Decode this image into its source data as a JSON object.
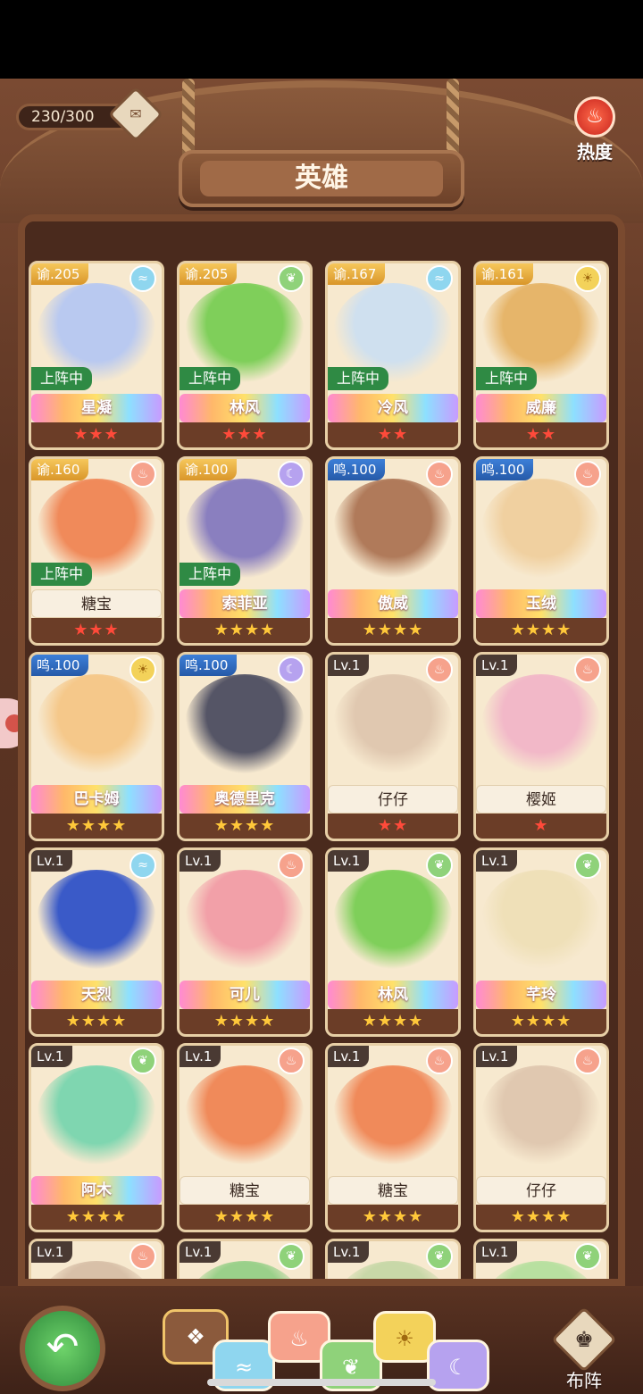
{
  "header": {
    "counter": "230/300",
    "title": "英雄",
    "hot_label": "热度"
  },
  "heroes": [
    {
      "level": "谕.205",
      "level_style": "gold",
      "element": "water",
      "deployed": "上阵中",
      "name": "星凝",
      "ribbon": "rainbow",
      "stars": "★★★",
      "star_color": "red",
      "color": "#b9c9f0"
    },
    {
      "level": "谕.205",
      "level_style": "gold",
      "element": "leaf",
      "deployed": "上阵中",
      "name": "林风",
      "ribbon": "rainbow",
      "stars": "★★★",
      "star_color": "red",
      "color": "#7fcf5a"
    },
    {
      "level": "谕.167",
      "level_style": "gold",
      "element": "water",
      "deployed": "上阵中",
      "name": "冷风",
      "ribbon": "rainbow",
      "stars": "★★",
      "star_color": "red",
      "color": "#cfe0ef"
    },
    {
      "level": "谕.161",
      "level_style": "gold",
      "element": "sun",
      "deployed": "上阵中",
      "name": "威廉",
      "ribbon": "rainbow",
      "stars": "★★",
      "star_color": "red",
      "color": "#e6b56a"
    },
    {
      "level": "谕.160",
      "level_style": "gold",
      "element": "fire",
      "deployed": "上阵中",
      "name": "糖宝",
      "ribbon": "plain",
      "stars": "★★★",
      "star_color": "red",
      "color": "#f08a5a"
    },
    {
      "level": "谕.100",
      "level_style": "gold",
      "element": "moon",
      "deployed": "上阵中",
      "name": "索菲亚",
      "ribbon": "rainbow",
      "stars": "★★★★",
      "star_color": "gold",
      "color": "#8a7fbf"
    },
    {
      "level": "鸣.100",
      "level_style": "blue",
      "element": "fire",
      "deployed": "",
      "name": "傲威",
      "ribbon": "rainbow",
      "stars": "★★★★",
      "star_color": "gold",
      "color": "#b07a5a"
    },
    {
      "level": "鸣.100",
      "level_style": "blue",
      "element": "fire",
      "deployed": "",
      "name": "玉绒",
      "ribbon": "rainbow",
      "stars": "★★★★",
      "star_color": "gold",
      "color": "#f0d0a0"
    },
    {
      "level": "鸣.100",
      "level_style": "blue",
      "element": "sun",
      "deployed": "",
      "name": "巴卡姆",
      "ribbon": "rainbow",
      "stars": "★★★★",
      "star_color": "gold",
      "color": "#f5c88a"
    },
    {
      "level": "鸣.100",
      "level_style": "blue",
      "element": "moon",
      "deployed": "",
      "name": "奥德里克",
      "ribbon": "rainbow",
      "stars": "★★★★",
      "star_color": "gold",
      "color": "#555566"
    },
    {
      "level": "Lv.1",
      "level_style": "lv",
      "element": "fire",
      "deployed": "",
      "name": "仔仔",
      "ribbon": "plain",
      "stars": "★★",
      "star_color": "red",
      "color": "#e0c8b0"
    },
    {
      "level": "Lv.1",
      "level_style": "lv",
      "element": "fire",
      "deployed": "",
      "name": "樱姬",
      "ribbon": "plain",
      "stars": "★",
      "star_color": "red",
      "color": "#f2b8c8"
    },
    {
      "level": "Lv.1",
      "level_style": "lv",
      "element": "water",
      "deployed": "",
      "name": "天烈",
      "ribbon": "rainbow",
      "stars": "★★★★",
      "star_color": "gold",
      "color": "#3a5ac8"
    },
    {
      "level": "Lv.1",
      "level_style": "lv",
      "element": "fire",
      "deployed": "",
      "name": "可儿",
      "ribbon": "rainbow",
      "stars": "★★★★",
      "star_color": "gold",
      "color": "#f2a0a8"
    },
    {
      "level": "Lv.1",
      "level_style": "lv",
      "element": "leaf",
      "deployed": "",
      "name": "林风",
      "ribbon": "rainbow",
      "stars": "★★★★",
      "star_color": "gold",
      "color": "#7fcf5a"
    },
    {
      "level": "Lv.1",
      "level_style": "lv",
      "element": "leaf",
      "deployed": "",
      "name": "芊玲",
      "ribbon": "rainbow",
      "stars": "★★★★",
      "star_color": "gold",
      "color": "#efe0b8"
    },
    {
      "level": "Lv.1",
      "level_style": "lv",
      "element": "leaf",
      "deployed": "",
      "name": "阿木",
      "ribbon": "rainbow",
      "stars": "★★★★",
      "star_color": "gold",
      "color": "#7fd6b0"
    },
    {
      "level": "Lv.1",
      "level_style": "lv",
      "element": "fire",
      "deployed": "",
      "name": "糖宝",
      "ribbon": "plain",
      "stars": "★★★★",
      "star_color": "gold",
      "color": "#f08a5a"
    },
    {
      "level": "Lv.1",
      "level_style": "lv",
      "element": "fire",
      "deployed": "",
      "name": "糖宝",
      "ribbon": "plain",
      "stars": "★★★★",
      "star_color": "gold",
      "color": "#f08a5a"
    },
    {
      "level": "Lv.1",
      "level_style": "lv",
      "element": "fire",
      "deployed": "",
      "name": "仔仔",
      "ribbon": "plain",
      "stars": "★★★★",
      "star_color": "gold",
      "color": "#e0c8b0"
    },
    {
      "level": "Lv.1",
      "level_style": "lv",
      "element": "fire",
      "deployed": "",
      "name": "",
      "ribbon": "plain",
      "stars": "",
      "star_color": "gold",
      "color": "#d8c0a8"
    },
    {
      "level": "Lv.1",
      "level_style": "lv",
      "element": "leaf",
      "deployed": "",
      "name": "",
      "ribbon": "plain",
      "stars": "",
      "star_color": "gold",
      "color": "#9ad08a"
    },
    {
      "level": "Lv.1",
      "level_style": "lv",
      "element": "leaf",
      "deployed": "",
      "name": "",
      "ribbon": "plain",
      "stars": "",
      "star_color": "gold",
      "color": "#c8d8a8"
    },
    {
      "level": "Lv.1",
      "level_style": "lv",
      "element": "leaf",
      "deployed": "",
      "name": "",
      "ribbon": "plain",
      "stars": "",
      "star_color": "gold",
      "color": "#b8e0a0"
    }
  ],
  "element_glyphs": {
    "water": "≈",
    "leaf": "❦",
    "sun": "☀",
    "fire": "♨",
    "moon": "☾"
  },
  "filters": [
    {
      "key": "all",
      "glyph": "❖"
    },
    {
      "key": "water",
      "glyph": "≈"
    },
    {
      "key": "fire",
      "glyph": "♨"
    },
    {
      "key": "leaf",
      "glyph": "❦"
    },
    {
      "key": "sun",
      "glyph": "☀"
    },
    {
      "key": "moon",
      "glyph": "☾"
    }
  ],
  "footer": {
    "back_glyph": "↶",
    "formation_glyph": "♚",
    "formation_label": "布阵"
  }
}
